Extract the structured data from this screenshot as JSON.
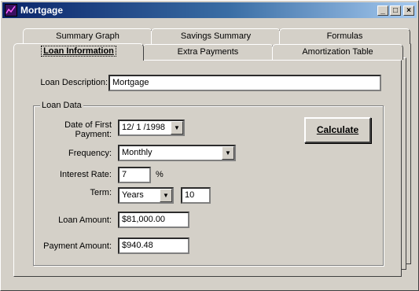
{
  "window": {
    "title": "Mortgage",
    "minimize_label": "_",
    "maximize_label": "□",
    "close_label": "×"
  },
  "tabs": {
    "row_back": [
      "Summary Graph",
      "Savings Summary",
      "Formulas"
    ],
    "row_front": [
      "Loan Information",
      "Extra Payments",
      "Amortization Table"
    ],
    "active": "Loan Information"
  },
  "form": {
    "loan_description_label": "Loan Description:",
    "loan_description_value": "Mortgage",
    "group_title": "Loan Data",
    "first_payment_label_1": "Date of First",
    "first_payment_label_2": "Payment:",
    "first_payment_value": "12/ 1 /1998",
    "frequency_label": "Frequency:",
    "frequency_value": "Monthly",
    "interest_label": "Interest Rate:",
    "interest_value": "7",
    "interest_unit": "%",
    "term_label": "Term:",
    "term_unit_value": "Years",
    "term_value": "10",
    "loan_amount_label": "Loan Amount:",
    "loan_amount_value": "$81,000.00",
    "payment_amount_label": "Payment Amount:",
    "payment_amount_value": "$940.48",
    "calculate_label": "Calculate"
  }
}
